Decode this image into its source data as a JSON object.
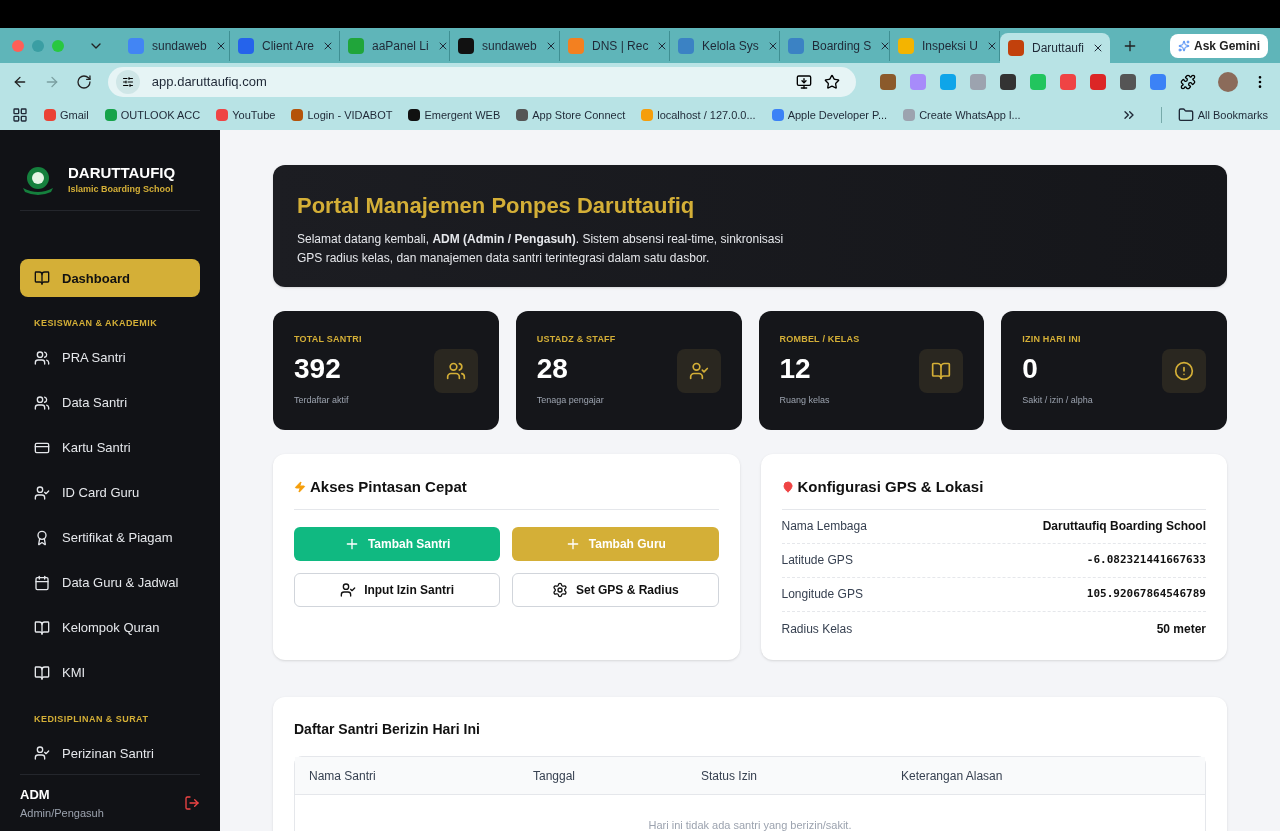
{
  "browser": {
    "tabs": [
      {
        "title": "sundaweb",
        "selected": false
      },
      {
        "title": "Client Are",
        "selected": false
      },
      {
        "title": "aaPanel Li",
        "selected": false
      },
      {
        "title": "sundaweb",
        "selected": false
      },
      {
        "title": "DNS | Rec",
        "selected": false
      },
      {
        "title": "Kelola Sys",
        "selected": false
      },
      {
        "title": "Boarding S",
        "selected": false
      },
      {
        "title": "Inspeksi U",
        "selected": false
      },
      {
        "title": "Daruttaufi",
        "selected": true
      }
    ],
    "gemini": "Ask Gemini",
    "url": "app.daruttaufiq.com",
    "bookmarks": [
      "Gmail",
      "OUTLOOK ACC",
      "YouTube",
      "Login - VIDABOT",
      "Emergent WEB",
      "App Store Connect",
      "localhost / 127.0.0...",
      "Apple Developer P...",
      "Create WhatsApp l..."
    ],
    "all_bookmarks": "All Bookmarks"
  },
  "sidebar": {
    "brand": "DARUTTAUFIQ",
    "tagline": "Islamic Boarding School",
    "items": [
      {
        "kind": "item",
        "label": "Dashboard",
        "selected": true
      },
      {
        "kind": "section",
        "label": "KESISWAAN & AKADEMIK"
      },
      {
        "kind": "item",
        "label": "PRA Santri",
        "selected": false
      },
      {
        "kind": "item",
        "label": "Data Santri",
        "selected": false
      },
      {
        "kind": "item",
        "label": "Kartu Santri",
        "selected": false
      },
      {
        "kind": "item",
        "label": "ID Card Guru",
        "selected": false
      },
      {
        "kind": "item",
        "label": "Sertifikat & Piagam",
        "selected": false
      },
      {
        "kind": "item",
        "label": "Data Guru & Jadwal",
        "selected": false
      },
      {
        "kind": "item",
        "label": "Kelompok Quran",
        "selected": false
      },
      {
        "kind": "item",
        "label": "KMI",
        "selected": false
      },
      {
        "kind": "section",
        "label": "KEDISIPLINAN & SURAT"
      },
      {
        "kind": "item",
        "label": "Perizinan Santri",
        "selected": false
      }
    ],
    "user": {
      "name": "ADM",
      "role": "Admin/Pengasuh"
    }
  },
  "hero": {
    "title": "Portal Manajemen Ponpes Daruttaufiq",
    "text": "Selamat datang kembali, **ADM (Admin / Pengasuh)**. Sistem absensi real-time, sinkronisasi GPS radius kelas, dan manajemen data santri terintegrasi dalam satu dasbor."
  },
  "stats": [
    {
      "label": "TOTAL SANTRI",
      "value": "392",
      "note": "Terdaftar aktif"
    },
    {
      "label": "USTADZ & STAFF",
      "value": "28",
      "note": "Tenaga pengajar"
    },
    {
      "label": "ROMBEL / KELAS",
      "value": "12",
      "note": "Ruang kelas"
    },
    {
      "label": "IZIN HARI INI",
      "value": "0",
      "note": "Sakit / izin / alpha"
    }
  ],
  "shortcuts": {
    "title": "Akses Pintasan Cepat",
    "buttons": [
      {
        "kind": "primary",
        "label": "Tambah Santri",
        "color": "#10b981"
      },
      {
        "kind": "primary",
        "label": "Tambah Guru",
        "color": "#d4af37"
      },
      {
        "kind": "outline",
        "label": "Input Izin Santri"
      },
      {
        "kind": "outline",
        "label": "Set GPS & Radius"
      }
    ]
  },
  "gps": {
    "title": "Konfigurasi GPS & Lokasi",
    "rows": [
      {
        "label": "Nama Lembaga",
        "value": "Daruttaufiq Boarding School",
        "kind": "text"
      },
      {
        "label": "Latitude GPS",
        "value": "-6.082321441667633",
        "kind": "mono"
      },
      {
        "label": "Longitude GPS",
        "value": "105.92067864546789",
        "kind": "mono"
      },
      {
        "label": "Radius Kelas",
        "value": "50 meter",
        "kind": "text"
      }
    ]
  },
  "permits": {
    "title": "Daftar Santri Berizin Hari Ini",
    "columns": [
      "Nama Santri",
      "Tanggal",
      "Status Izin",
      "Keterangan Alasan"
    ],
    "empty": "Hari ini tidak ada santri yang berizin/sakit."
  }
}
